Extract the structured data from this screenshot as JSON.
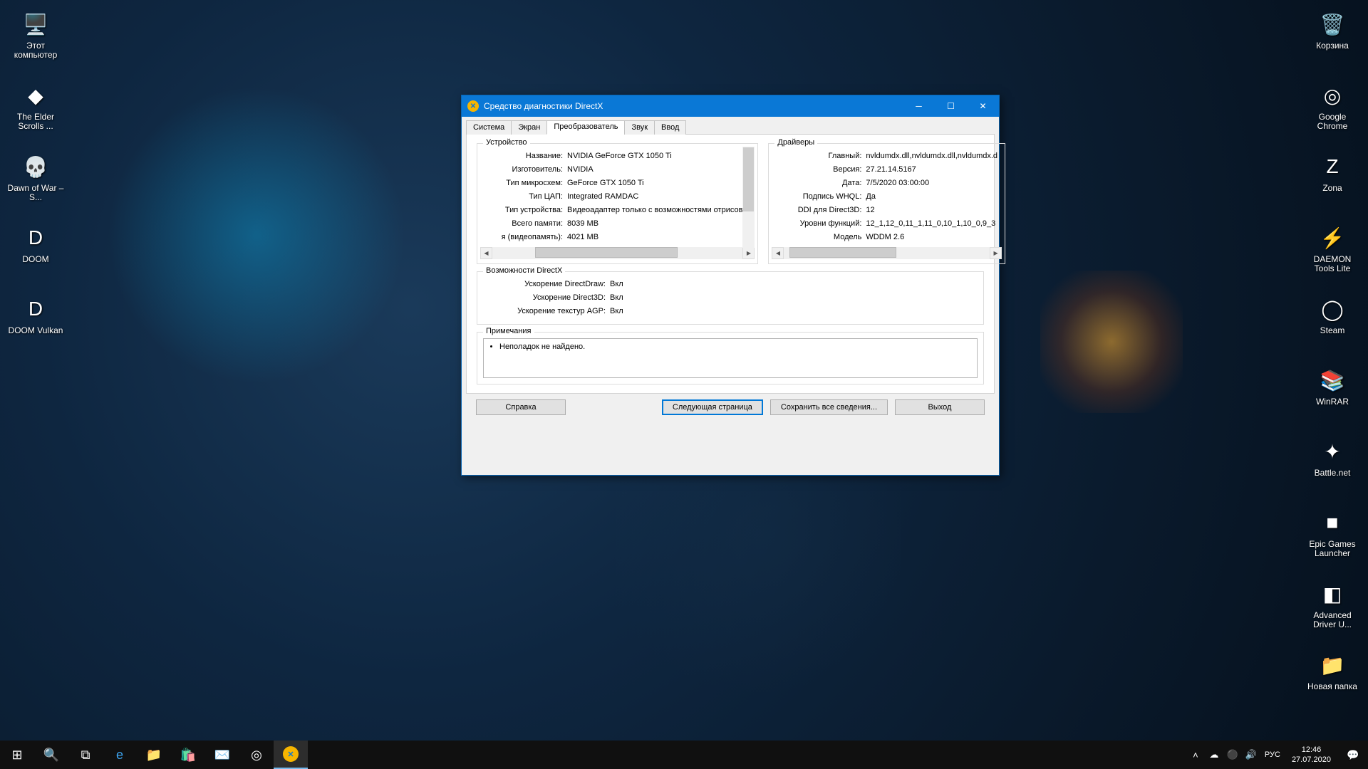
{
  "desktop_left": [
    {
      "label": "Этот компьютер",
      "icon": "🖥️"
    },
    {
      "label": "The Elder Scrolls ...",
      "icon": "◆"
    },
    {
      "label": "Dawn of War – S...",
      "icon": "💀"
    },
    {
      "label": "DOOM",
      "icon": "D"
    },
    {
      "label": "DOOM Vulkan",
      "icon": "D"
    }
  ],
  "desktop_right": [
    {
      "label": "Корзина",
      "icon": "🗑️"
    },
    {
      "label": "Google Chrome",
      "icon": "◎"
    },
    {
      "label": "Zona",
      "icon": "Z"
    },
    {
      "label": "DAEMON Tools Lite",
      "icon": "⚡"
    },
    {
      "label": "Steam",
      "icon": "◯"
    },
    {
      "label": "WinRAR",
      "icon": "📚"
    },
    {
      "label": "Battle.net",
      "icon": "✦"
    },
    {
      "label": "Epic Games Launcher",
      "icon": "■"
    },
    {
      "label": "Advanced Driver U...",
      "icon": "◧"
    },
    {
      "label": "Новая папка",
      "icon": "📁"
    }
  ],
  "window": {
    "title": "Средство диагностики DirectX",
    "tabs": [
      "Система",
      "Экран",
      "Преобразователь",
      "Звук",
      "Ввод"
    ],
    "active_tab": 2,
    "device": {
      "legend": "Устройство",
      "rows": [
        {
          "k": "Название:",
          "v": "NVIDIA GeForce GTX 1050 Ti"
        },
        {
          "k": "Изготовитель:",
          "v": "NVIDIA"
        },
        {
          "k": "Тип микросхем:",
          "v": "GeForce GTX 1050 Ti"
        },
        {
          "k": "Тип ЦАП:",
          "v": "Integrated RAMDAC"
        },
        {
          "k": "Тип устройства:",
          "v": "Видеоадаптер только с возможностями отрисовки"
        },
        {
          "k": "Всего памяти:",
          "v": "8039 MB"
        },
        {
          "k": "я (видеопамять):",
          "v": "4021 MB"
        }
      ]
    },
    "drivers": {
      "legend": "Драйверы",
      "rows": [
        {
          "k": "Главный:",
          "v": "nvldumdx.dll,nvldumdx.dll,nvldumdx.d"
        },
        {
          "k": "Версия:",
          "v": "27.21.14.5167"
        },
        {
          "k": "Дата:",
          "v": "7/5/2020 03:00:00"
        },
        {
          "k": "Подпись WHQL:",
          "v": "Да"
        },
        {
          "k": "DDI для Direct3D:",
          "v": "12"
        },
        {
          "k": "Уровни функций:",
          "v": "12_1,12_0,11_1,11_0,10_1,10_0,9_3"
        },
        {
          "k": "Модель",
          "v": "WDDM 2.6"
        }
      ]
    },
    "dx": {
      "legend": "Возможности DirectX",
      "rows": [
        {
          "k": "Ускорение DirectDraw:",
          "v": "Вкл"
        },
        {
          "k": "Ускорение Direct3D:",
          "v": "Вкл"
        },
        {
          "k": "Ускорение текстур AGP:",
          "v": "Вкл"
        }
      ]
    },
    "notes": {
      "legend": "Примечания",
      "item": "Неполадок не найдено."
    },
    "buttons": {
      "help": "Справка",
      "next": "Следующая страница",
      "save": "Сохранить все сведения...",
      "exit": "Выход"
    }
  },
  "tray": {
    "lang": "РУС",
    "time": "12:46",
    "date": "27.07.2020"
  }
}
